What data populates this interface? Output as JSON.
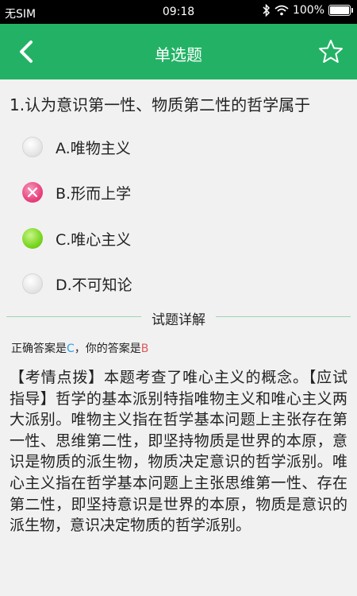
{
  "status_bar": {
    "carrier": "无SIM",
    "time": "09:18",
    "battery": "100%",
    "icons": [
      "bluetooth-icon",
      "wifi-icon",
      "battery-icon"
    ]
  },
  "nav": {
    "title": "单选题",
    "back_icon": "chevron-left-icon",
    "favorite_icon": "star-outline-icon"
  },
  "question": {
    "text": "1.认为意识第一性、物质第二性的哲学属于",
    "options": [
      {
        "label": "A.唯物主义",
        "state": "unselected"
      },
      {
        "label": "B.形而上学",
        "state": "wrong"
      },
      {
        "label": "C.唯心主义",
        "state": "correct"
      },
      {
        "label": "D.不可知论",
        "state": "unselected"
      }
    ]
  },
  "explanation": {
    "section_title": "试题详解",
    "correct_prefix": "正确答案是",
    "correct_answer": "C",
    "user_prefix": "，你的答案是",
    "user_answer": "B",
    "body": "【考情点拨】本题考查了唯心主义的概念。【应试指导】哲学的基本派别特指唯物主义和唯心主义两大派别。唯物主义指在哲学基本问题上主张存在第一性、思维第二性，即坚持物质是世界的本原，意识是物质的派生物，物质决定意识的哲学派别。唯心主义指在哲学基本问题上主张思维第一性、存在第二性，即坚持意识是世界的本原，物质是意识的派生物，意识决定物质的哲学派别。"
  },
  "colors": {
    "primary_green": "#23b265",
    "wrong_pink": "#e9437f",
    "correct_green": "#79d620",
    "correct_letter_blue": "#2f9ee8",
    "wrong_letter_red": "#e05a5a"
  }
}
